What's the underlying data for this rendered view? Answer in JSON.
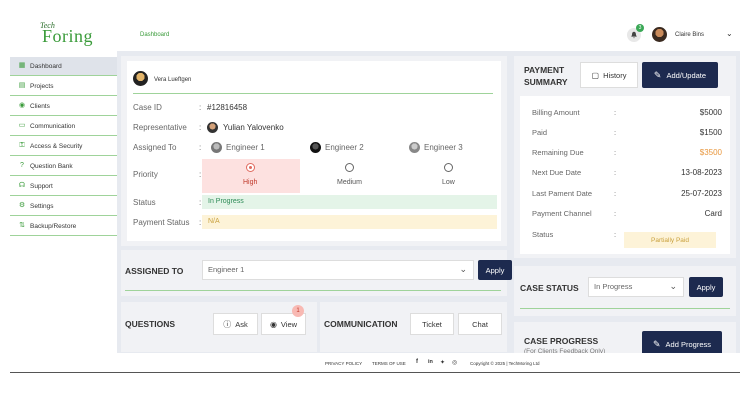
{
  "app": {
    "logo_top": "Tech",
    "logo_main": "Foring",
    "breadcrumb": "Dashboard",
    "notification_count": "3",
    "user_name": "Claire Bins"
  },
  "sidebar": {
    "items": [
      {
        "label": "Dashboard",
        "icon": "grid-icon",
        "active": true
      },
      {
        "label": "Projects",
        "icon": "clipboard-icon"
      },
      {
        "label": "Clients",
        "icon": "user-icon"
      },
      {
        "label": "Communication",
        "icon": "chat-icon"
      },
      {
        "label": "Access & Security",
        "icon": "key-icon"
      },
      {
        "label": "Question Bank",
        "icon": "question-icon"
      },
      {
        "label": "Support",
        "icon": "headset-icon"
      },
      {
        "label": "Settings",
        "icon": "gear-icon"
      },
      {
        "label": "Backup/Restore",
        "icon": "backup-icon"
      }
    ]
  },
  "case": {
    "owner_name": "Vera Lueftgen",
    "id_label": "Case ID",
    "id_value": "#12816458",
    "rep_label": "Representative",
    "rep_value": "Yulian Yalovenko",
    "assigned_label": "Assigned To",
    "engineers": [
      "Engineer 1",
      "Engineer 2",
      "Engineer 3"
    ],
    "priority_label": "Priority",
    "priorities": [
      "High",
      "Medium",
      "Low"
    ],
    "selected_priority": "High",
    "status_label": "Status",
    "status_value": "In Progress",
    "payment_status_label": "Payment Status",
    "payment_status_value": "N/A"
  },
  "assign": {
    "title": "ASSIGNED TO",
    "selected": "Engineer 1",
    "apply_label": "Apply"
  },
  "questions": {
    "title": "QUESTIONS",
    "ask_label": "Ask",
    "view_label": "View",
    "view_badge": "1"
  },
  "communication": {
    "title": "COMMUNICATION",
    "ticket_label": "Ticket",
    "chat_label": "Chat"
  },
  "payment": {
    "title": "PAYMENT SUMMARY",
    "history_label": "History",
    "add_update_label": "Add/Update",
    "rows": [
      {
        "label": "Billing Amount",
        "value": "$5000"
      },
      {
        "label": "Paid",
        "value": "$1500"
      },
      {
        "label": "Remaining Due",
        "value": "$3500"
      },
      {
        "label": "Next Due Date",
        "value": "13-08-2023"
      },
      {
        "label": "Last Pament Date",
        "value": "25-07-2023"
      },
      {
        "label": "Payment Channel",
        "value": "Card"
      }
    ],
    "status_label": "Status",
    "status_value": "Partially Paid",
    "remaining_color": "#e8963c"
  },
  "case_status": {
    "title": "CASE STATUS",
    "selected": "In Progress",
    "apply_label": "Apply"
  },
  "case_progress": {
    "title": "CASE PROGRESS",
    "subtitle": "(For Clients Feedback Only)",
    "button_label": "Add Progress"
  },
  "footer": {
    "privacy": "PRIVACY POLICY",
    "terms": "TERMS OF USE",
    "copyright": "Copyright © 2025 | TechMoring Ltd"
  },
  "colors": {
    "brand_green": "#3a9b3a",
    "primary_dark": "#1d2a4f",
    "high_bg": "#fde1e0",
    "success": "#2e8b57",
    "warning": "#c9a13e"
  }
}
